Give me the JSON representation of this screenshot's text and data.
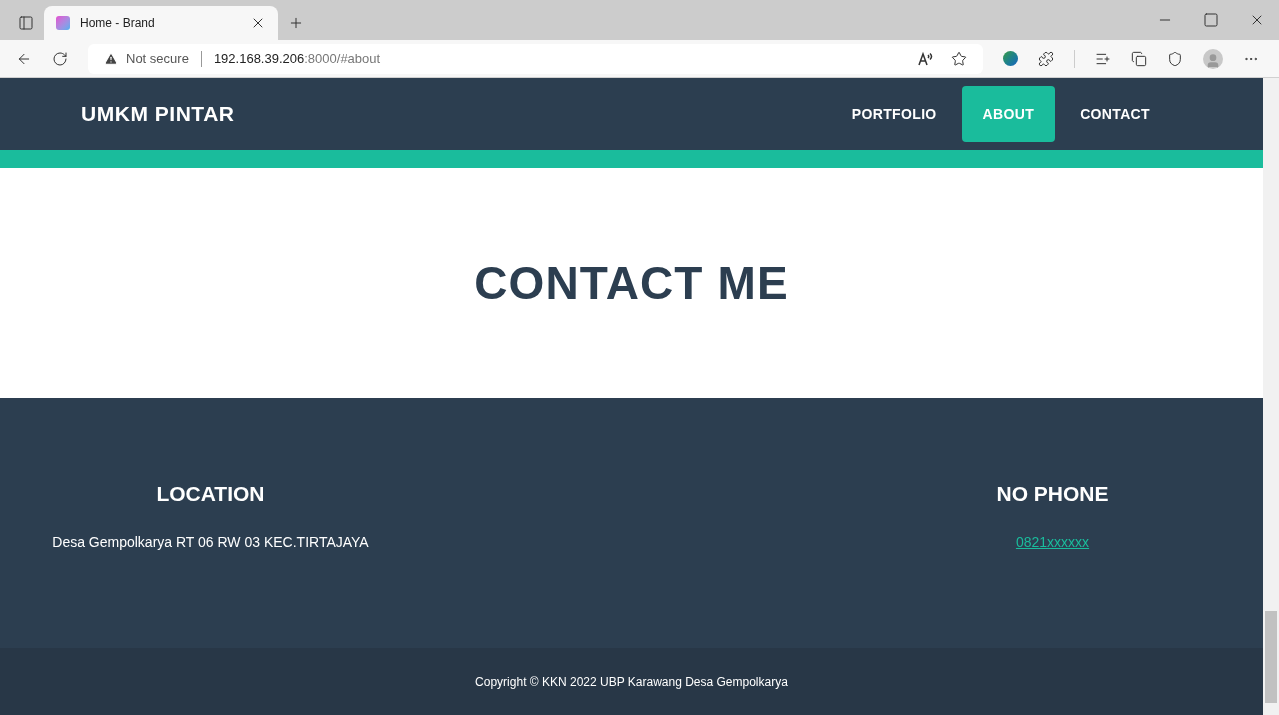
{
  "browser": {
    "tab_title": "Home - Brand",
    "security": "Not secure",
    "url_host": "192.168.39.206",
    "url_rest": ":8000/#about"
  },
  "navbar": {
    "brand": "UMKM PINTAR",
    "links": [
      {
        "label": "PORTFOLIO",
        "selected": false
      },
      {
        "label": "ABOUT",
        "selected": true
      },
      {
        "label": "CONTACT",
        "selected": false
      }
    ]
  },
  "contact": {
    "heading": "CONTACT ME"
  },
  "footer": {
    "columns": [
      {
        "kind": "text",
        "title": "LOCATION",
        "content": "Desa Gempolkarya RT 06 RW 03 KEC.TIRTAJAYA"
      },
      {
        "kind": "link",
        "title": "NO PHONE",
        "content": "0821xxxxxx"
      }
    ],
    "copyright": "Copyright © KKN 2022 UBP Karawang Desa Gempolkarya"
  }
}
